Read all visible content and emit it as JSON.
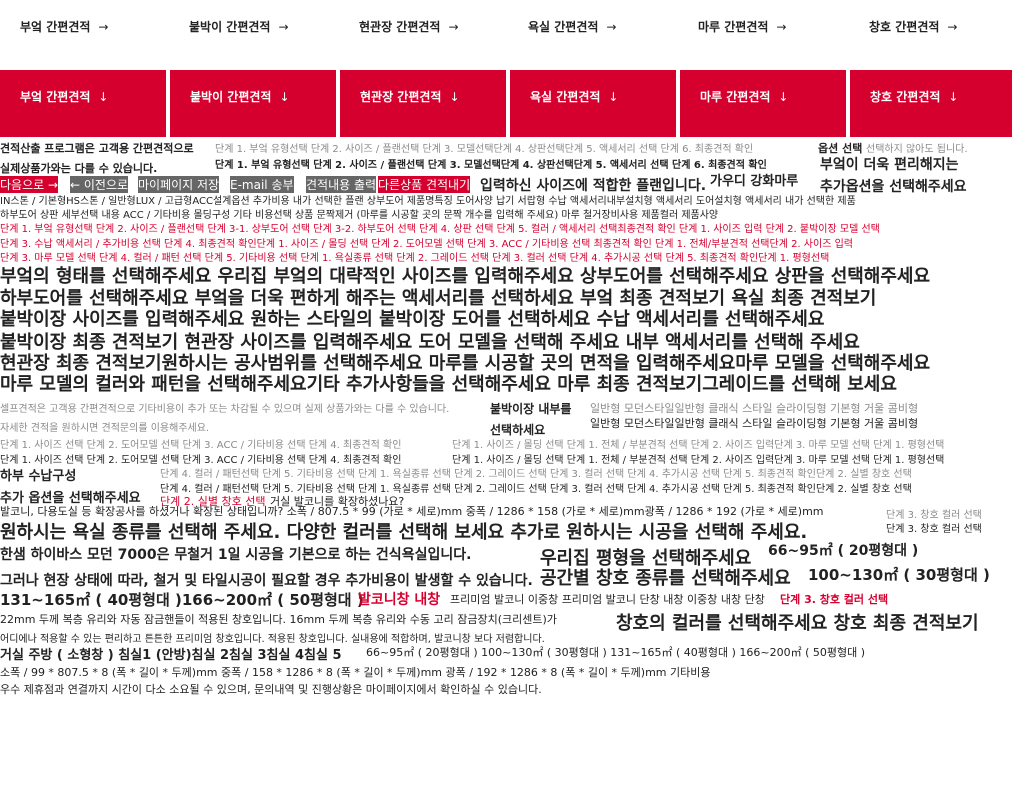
{
  "top_nav": [
    {
      "label": "부엌 간편견적",
      "arrow": "→"
    },
    {
      "label": "붙박이 간편견적",
      "arrow": "→"
    },
    {
      "label": "현관장 간편견적",
      "arrow": "→"
    },
    {
      "label": "욕실 간편견적",
      "arrow": "→"
    },
    {
      "label": "마루 간편견적",
      "arrow": "→"
    },
    {
      "label": "창호 간편견적",
      "arrow": "→"
    }
  ],
  "red_nav": [
    {
      "label": "부엌 간편견적",
      "arrow": "↓"
    },
    {
      "label": "붙박이 간편견적",
      "arrow": "↓"
    },
    {
      "label": "현관장 간편견적",
      "arrow": "↓"
    },
    {
      "label": "욕실 간편견적",
      "arrow": "↓"
    },
    {
      "label": "마루 간편견적",
      "arrow": "↓"
    },
    {
      "label": "창호 간편견적",
      "arrow": "↓"
    }
  ],
  "lines": {
    "l1a": "견적산출 프로그램은 고객용 간편견적으로",
    "l1b": "단계 1. 부엌 유형선택  단계 2. 사이즈 / 플랜선택 단계 3. 모델선택단계 4. 상판선택단계 5. 액세서리 선택 단계 6. 최종견적 확인",
    "l1c": "옵션 선택",
    "l1d": "선택하지 않아도 됩니다.",
    "l2a": "실제상품가와는 다를 수 있습니다.",
    "l2b": "단계 1. 부엌 유형선택  단계 2. 사이즈 / 플랜선택 단계 3. 모델선택단계 4. 상판선택단계 5. 액세서리 선택 단계 6. 최종견적 확인",
    "l2c": "부엌이 더욱 편리해지는",
    "btn_next": "다음으로  →",
    "btn_prev": "← 이전으로",
    "btn_mypage": "마이페이지 저장",
    "btn_email": "E-mail 송부",
    "btn_email2": "견적내용 출력",
    "btn_other": "다른상품 견적내기",
    "l3b": "입력하신 사이즈에 적합한 플랜입니다.",
    "l3c": "가우디 강화마루",
    "l3d": "추가옵션을 선택해주세요",
    "l4": "IN스톤 / 기본형HS스톤 / 일반형LUX / 고급형ACC설계옵션 추가비용 내가 선택한 플랜 상부도어 제품명특징 도어사양 납기 서랍형 수납 액세서리내부설치형 액세서리 도어설치형 액세서리 내가 선택한 제품",
    "l5": "하부도어 상판 세부선택 내용 ACC / 기타비용 몰딩구성 기타 비용선택 상품 문짝제거 (마루를 시공할 곳의 문짝 개수를 입력해 주세요) 마루 철거장비사용 제품컬러 제품사양",
    "r1": "단계 1. 부엌 유형선택 단계 2. 사이즈 / 플랜선택 단계 3-1. 상부도어 선택 단계 3-2. 하부도어 선택 단계 4. 상판 선택 단계 5. 컬러 / 액세서리 선택최종견적 확인 단계 1. 사이즈 입력 단계 2. 붙박이장 모델 선택",
    "r2": "단계 3. 수납 액세서리 / 추가비용 선택 단계 4. 최종견적 확인단계 1. 사이즈 / 몰딩 선택 단계 2. 도어모델 선택 단계 3. ACC / 기타비용 선택 최종견적 확인 단계 1. 전체/부분견적 선택단계 2. 사이즈 입력",
    "r3": "단계 3. 마루 모델 선택 단계 4. 컬러 / 패턴 선택 단계 5. 기타비용 선택 단계 1. 욕실종류 선택 단계 2. 그레이드 선택 단계 3. 컬러 선택 단계 4. 추가시공 선택 단계 5. 최종견적 확인단계 1. 평형선택",
    "big1": "부엌의 형태를 선택해주세요 우리집 부엌의 대략적인 사이즈를 입력해주세요 상부도어를 선택해주세요 상판을 선택해주세요",
    "big2": "하부도어를 선택해주세요 부엌을 더욱 편하게 해주는 액세서리를 선택하세요 부엌 최종 견적보기  욕실 최종 견적보기",
    "big3": "붙박이장 사이즈를 입력해주세요 원하는 스타일의 붙박이장 도어를 선택하세요 수납 액세서리를 선택해주세요",
    "big4": "붙박이장 최종 견적보기 현관장 사이즈를 입력해주세요 도어 모델을 선택해 주세요 내부 액세서리를 선택해 주세요",
    "big5": "현관장 최종 견적보기원하시는 공사범위를 선택해주세요 마루를 시공할 곳의 면적을 입력해주세요마루 모델을 선택해주세요",
    "big6": "마루 모델의 컬러와 패턴을 선택해주세요기타 추가사항들을 선택해주세요 마루 최종 견적보기그레이드를 선택해 보세요",
    "m1a": "셀프견적은 고객용 간편견적으로 기타비용이 추가 또는 차감될 수 있으며 실제 상품가와는 다를 수 있습니다.",
    "m1b": "붙박이장 내부를",
    "m1c": "일반형 모던스타일일반형 클래식 스타일 슬라이딩형 기본형 거울 콤비형",
    "m2a": "자세한 견적을 원하시면 견적문의를 이용해주세요.",
    "m2b": "선택하세요",
    "m2c": "일반형 모던스타일일반형 클래식 스타일 슬라이딩형 기본형 거울 콤비형",
    "m3a": "단계 1. 사이즈 선택 단계 2. 도어모델 선택 단계 3. ACC / 기타비용 선택 단계 4. 최종견적 확인",
    "m3b": "단계 1. 사이즈 / 몰딩 선택 단계 1. 전체 / 부분견적 선택 단계 2. 사이즈 입력단계 3. 마루 모델 선택 단계 1. 평형선택",
    "m4a": "단계 1. 사이즈 선택 단계 2. 도어모델 선택 단계 3. ACC / 기타비용 선택 단계 4. 최종견적 확인",
    "m4b": "단계 1. 사이즈 / 몰딩 선택 단계 1. 전체 / 부분견적 선택 단계 2. 사이즈 입력단계 3. 마루 모델 선택 단계 1. 평형선택",
    "m5a": "하부 수납구성",
    "m5b": "단계 4. 컬러 / 패턴선택 단계 5. 기타비용 선택 단계 1. 욕실종류 선택 단계 2. 그레이드 선택 단계 3. 컬러 선택 단계 4. 추가시공 선택 단계 5. 최종견적 확인단계 2. 실별 창호 선택",
    "m6a": "추가 옵션을 선택해주세요",
    "m6b": "단계 4. 컬러 / 패턴선택 단계 5. 기타비용 선택 단계 1. 욕실종류 선택 단계 2. 그레이드 선택 단계 3. 컬러 선택 단계 4. 추가시공 선택 단계 5. 최종견적 확인단계 2. 실별 창호 선택",
    "m7a": "단계 2. 실별 창호 선택",
    "m7b": "거실 발코니를 확장하셨나요?",
    "m8a": "발코니, 다용도실 등 확장공사를 하셨거나 확장된 상태입니까? 소폭 / 807.5 * 99 (가로 * 세로)mm 중폭 / 1286 * 158 (가로 * 세로)mm광폭 / 1286 * 192 (가로 * 세로)mm",
    "m8b": "단계 3. 창호 컬러 선택",
    "m9a": "원하시는 욕실 종류를 선택해 주세요. 다양한 컬러를 선택해 보세요 추가로 원하시는 시공을 선택해 주세요.",
    "m9b": "단계 3. 창호 컬러 선택",
    "m10a": "한샘 하이바스 모던 7000은 무철거 1일 시공을 기본으로 하는 건식욕실입니다.",
    "m10b": "우리집 평형을 선택해주세요",
    "m10c": "66~95㎡ ( 20평형대 )",
    "m11a": "그러나 현장 상태에 따라, 철거 및 타일시공이 필요할 경우 추가비용이 발생할 수 있습니다.",
    "m11b": "공간별 창호 종류를 선택해주세요",
    "m11c": "100~130㎡ ( 30평형대 )",
    "m12a": "131~165㎡ ( 40평형대 )166~200㎡ ( 50평형대 )",
    "m12b": "발코니창 내창",
    "m12c": "프리미엄 발코니 이중창 프리미엄 발코니 단창 내창 이중창 내창 단창",
    "m12d": "단계 3. 창호 컬러 선택",
    "m13a": "22mm 두께 복층 유리와 자동 잠금핸들이 적용된 창호입니다.      16mm 두께 복층 유리와 수동 고리 잠금장치(크리센트)가",
    "m13b": "창호의 컬러를 선택해주세요 창호 최종 견적보기",
    "m14": "어디에나 적용할 수 있는 편리하고 튼튼한  프리미엄 창호입니다.  적용된 창호입니다. 실내용에 적합하며, 발코니창 보다 저렴합니다.",
    "m15a": "거실 주방 ( 소형창 ) 침실1 (안방)침실 2침실 3침실 4침실 5",
    "m15b": "66~95㎡ ( 20평형대 ) 100~130㎡ ( 30평형대 ) 131~165㎡ ( 40평형대 ) 166~200㎡ ( 50평형대 )",
    "m16": "소폭 / 99 * 807.5 * 8 (폭 * 길이 * 두께)mm   중폭 / 158 * 1286 * 8 (폭 * 길이 * 두께)mm   광폭 / 192 * 1286 * 8 (폭 * 길이 * 두께)mm    기타비용",
    "m17": "우수 제휴점과 연결까지 시간이 다소 소요될 수 있으며, 문의내역 및 진행상황은 마이페이지에서 확인하실 수 있습니다."
  }
}
